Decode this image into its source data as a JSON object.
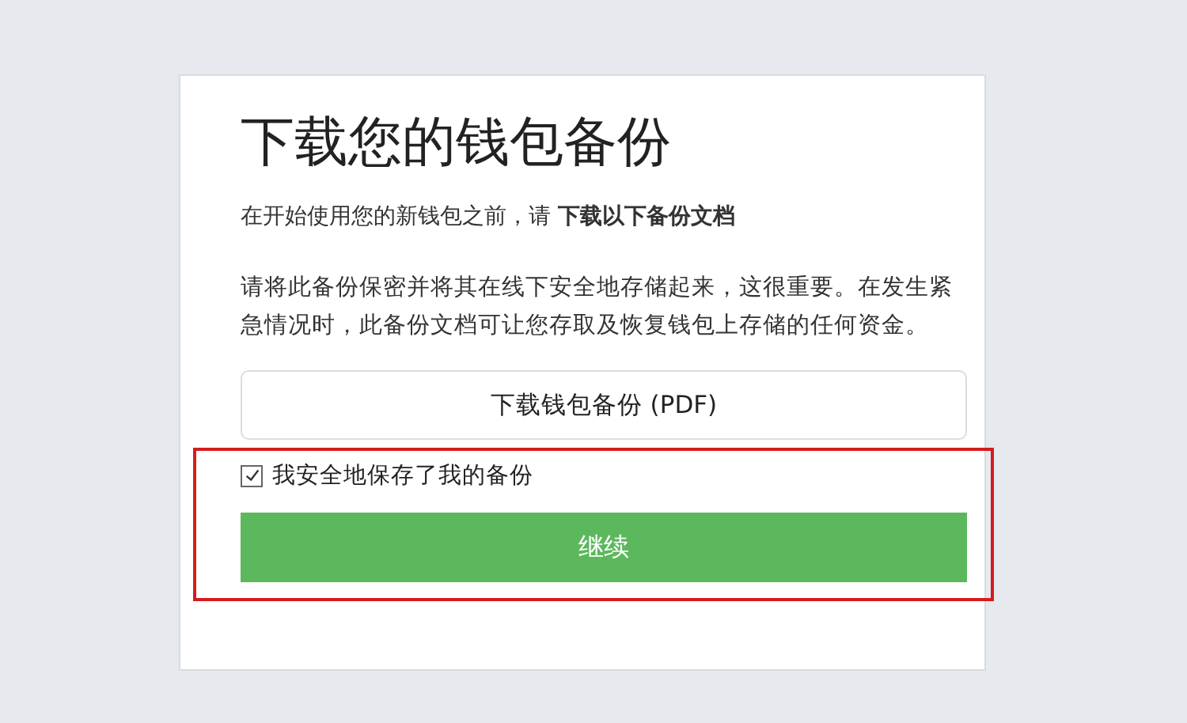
{
  "title": "下载您的钱包备份",
  "intro": "在开始使用您的新钱包之前，请 **下载以下备份文档**",
  "note": "请将此备份保密并将其在线下安全地存储起来，这很重要。在发生紧急情况时，此备份文档可让您存取及恢复钱包上存储的任何资金。",
  "download_button": "下载钱包备份 (PDF)",
  "highlight": {
    "checkbox": {
      "label": "我安全地保存了我的备份",
      "checked": true
    },
    "continue_button": "继续"
  }
}
